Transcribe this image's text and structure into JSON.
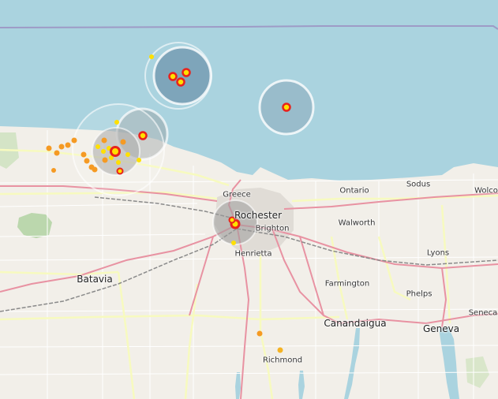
{
  "map": {
    "colors": {
      "water": "#aad3df",
      "land": "#f2efe9",
      "urban": "#e0dcd6",
      "road_primary": "#e892a2",
      "road_secondary": "#f7fabf",
      "road_minor": "#ffffff",
      "rail": "#8a8a8a",
      "border": "#9e9bc6",
      "marker_red": "#e8231c",
      "marker_orange": "#f59a23",
      "marker_yellow": "#ffe000"
    },
    "places": [
      {
        "id": "rochester",
        "name": "Rochester",
        "size": "big"
      },
      {
        "id": "greece",
        "name": "Greece",
        "size": "small"
      },
      {
        "id": "brighton",
        "name": "Brighton",
        "size": "small"
      },
      {
        "id": "henrietta",
        "name": "Henrietta",
        "size": "small"
      },
      {
        "id": "batavia",
        "name": "Batavia",
        "size": "big"
      },
      {
        "id": "ontario",
        "name": "Ontario",
        "size": "small"
      },
      {
        "id": "sodus",
        "name": "Sodus",
        "size": "small"
      },
      {
        "id": "wolcott",
        "name": "Wolco",
        "size": "small"
      },
      {
        "id": "walworth",
        "name": "Walworth",
        "size": "small"
      },
      {
        "id": "lyons",
        "name": "Lyons",
        "size": "small"
      },
      {
        "id": "farmington",
        "name": "Farmington",
        "size": "small"
      },
      {
        "id": "phelps",
        "name": "Phelps",
        "size": "small"
      },
      {
        "id": "canandaigua",
        "name": "Canandaigua",
        "size": "big"
      },
      {
        "id": "geneva",
        "name": "Geneva",
        "size": "big"
      },
      {
        "id": "seneca",
        "name": "Seneca",
        "size": "small"
      },
      {
        "id": "richmond",
        "name": "Richmond",
        "size": "small"
      }
    ],
    "events": [
      {
        "level": "red"
      },
      {
        "level": "red"
      },
      {
        "level": "red"
      },
      {
        "level": "red"
      },
      {
        "level": "red"
      },
      {
        "level": "red"
      },
      {
        "level": "red"
      },
      {
        "level": "red"
      },
      {
        "level": "orange"
      },
      {
        "level": "orange"
      },
      {
        "level": "yellow"
      }
    ]
  }
}
